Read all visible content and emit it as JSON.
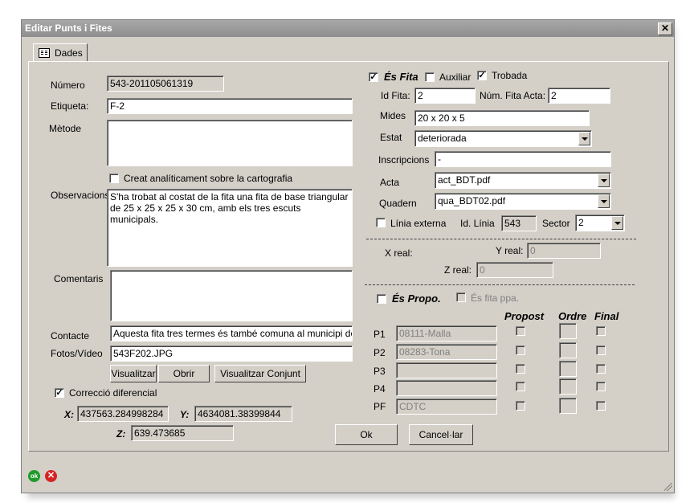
{
  "window": {
    "title": "Editar Punts i Fites",
    "close": "✕"
  },
  "tab": {
    "label": "Dades"
  },
  "left": {
    "numero_label": "Número",
    "numero": "543-201105061319",
    "etiqueta_label": "Etiqueta:",
    "etiqueta": "F-2",
    "metode_label": "Mètode",
    "metode": "",
    "creat_label": "Creat analíticament sobre la cartografia",
    "observacions_label": "Observacions",
    "observacions": "S'ha trobat al costat de la fita una fita de base triangular de 25 x 25 x  25 x 30 cm, amb els tres escuts municipals.",
    "comentaris_label": "Comentaris",
    "comentaris": "",
    "contacte_label": "Contacte",
    "contacte": "Aquesta fita tres termes és també comuna al municipi de T",
    "fotos_label": "Fotos/Vídeo",
    "fotos": "543F202.JPG",
    "btn_visualitzar": "Visualitzar",
    "btn_obrir": "Obrir",
    "btn_visualitzar_conjunt": "Visualitzar Conjunt",
    "correccio_label": "Correcció diferencial",
    "x_label": "X:",
    "x": "437563.284998284",
    "y_label": "Y:",
    "y": "4634081.38399844",
    "z_label": "Z:",
    "z": "639.473685"
  },
  "right": {
    "es_fita_label": "És Fita",
    "auxiliar_label": "Auxiliar",
    "trobada_label": "Trobada",
    "idfita_label": "Id Fita:",
    "idfita": "2",
    "numfita_label": "Núm. Fita Acta:",
    "numfita": "2",
    "mides_label": "Mides",
    "mides": "20 x 20 x 5",
    "estat_label": "Estat",
    "estat": "deteriorada",
    "inscripcions_label": "Inscripcions",
    "inscripcions": "-",
    "acta_label": "Acta",
    "acta": "act_BDT.pdf",
    "quadern_label": "Quadern",
    "quadern": "qua_BDT02.pdf",
    "linia_externa_label": "Línia externa",
    "idlinia_label": "Id. Línia",
    "idlinia": "543",
    "sector_label": "Sector",
    "sector": "2",
    "xreal_label": "X real:",
    "xreal": "",
    "yreal_label": "Y real:",
    "yreal": "0",
    "zreal_label": "Z real:",
    "zreal": "0",
    "es_propo_label": "És Propo.",
    "es_fita_ppa_label": "És fita ppa.",
    "col_propost": "Propost",
    "col_ordre": "Ordre",
    "col_final": "Final",
    "rows": [
      {
        "label": "P1",
        "value": "08111-Malla"
      },
      {
        "label": "P2",
        "value": "08283-Tona"
      },
      {
        "label": "P3",
        "value": ""
      },
      {
        "label": "P4",
        "value": ""
      },
      {
        "label": "PF",
        "value": "CDTC"
      }
    ]
  },
  "buttons": {
    "ok": "Ok",
    "cancel": "Cancel·lar"
  },
  "status": {
    "ok_icon": "ok",
    "cancel_icon": "✕"
  }
}
